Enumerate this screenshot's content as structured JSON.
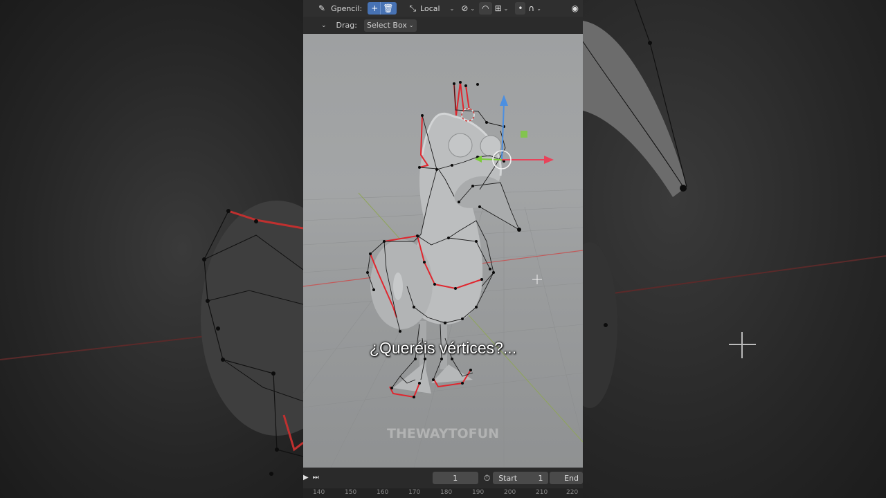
{
  "header": {
    "tool_label": "Gpencil:",
    "pivot_label": "Local",
    "drag_label": "Drag:",
    "drag_value": "Select Box",
    "icons": [
      "pencil-icon",
      "add-icon",
      "trash-icon",
      "transform-orientation-icon",
      "snap-link-icon",
      "proportional-icon",
      "snap-increment-icon",
      "falloff-dot-icon",
      "falloff-curve-icon",
      "overlay-eye-icon"
    ]
  },
  "viewport": {
    "subtitle": "¿Queréis vértices?...",
    "watermark": "THEWAYTOFUN",
    "colors": {
      "wire_selected": "#e0262e",
      "wire": "#1a1a1a",
      "gizmo_x": "#e8435a",
      "gizmo_y": "#7ccc3a",
      "gizmo_z": "#4c8fe0"
    }
  },
  "timeline": {
    "current_frame": "1",
    "start_label": "Start",
    "start_value": "1",
    "end_label": "End",
    "ruler_ticks": [
      "140",
      "150",
      "160",
      "170",
      "180",
      "190",
      "200",
      "210",
      "220"
    ]
  }
}
